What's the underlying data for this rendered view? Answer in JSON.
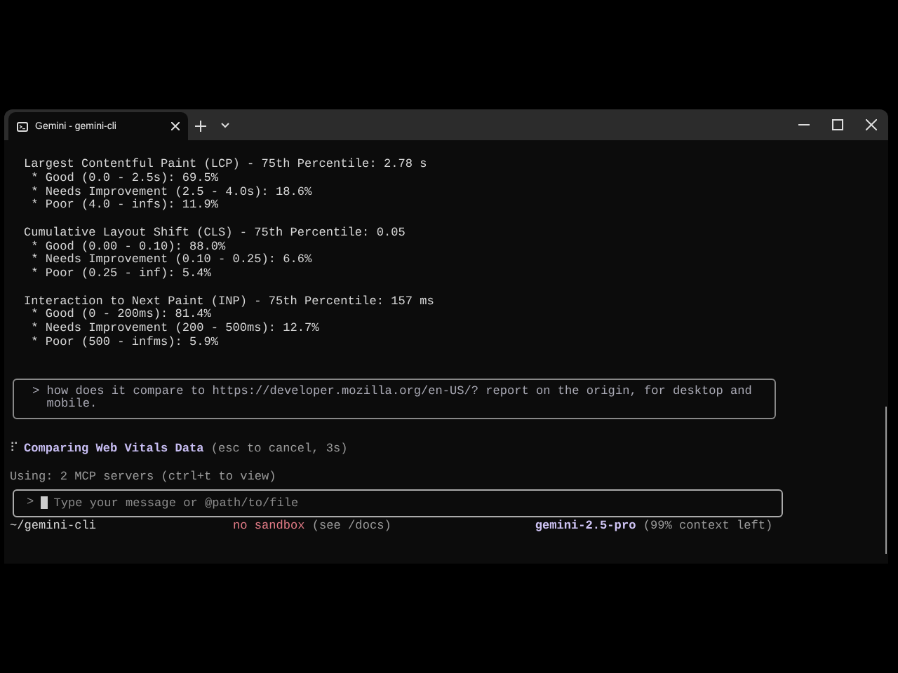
{
  "window": {
    "tabs": [
      {
        "title": "Gemini - gemini-cli",
        "selected": true
      }
    ]
  },
  "report": [
    {
      "heading": "Largest Contentful Paint (LCP) - 75th Percentile: 2.78 s",
      "items": [
        "* Good (0.0 - 2.5s): 69.5%",
        "* Needs Improvement (2.5 - 4.0s): 18.6%",
        "* Poor (4.0 - infs): 11.9%"
      ]
    },
    {
      "heading": "Cumulative Layout Shift (CLS) - 75th Percentile: 0.05",
      "items": [
        "* Good (0.00 - 0.10): 88.0%",
        "* Needs Improvement (0.10 - 0.25): 6.6%",
        "* Poor (0.25 - inf): 5.4%"
      ]
    },
    {
      "heading": "Interaction to Next Paint (INP) - 75th Percentile: 157 ms",
      "items": [
        "* Good (0 - 200ms): 81.4%",
        "* Needs Improvement (200 - 500ms): 12.7%",
        "* Poor (500 - infms): 5.9%"
      ]
    }
  ],
  "user_prompt": {
    "marker": ">",
    "text": "how does it compare to https://developer.mozilla.org/en-US/? report on the origin, for desktop and mobile."
  },
  "activity": {
    "spinner": "⠏",
    "title": "Comparing Web Vitals Data",
    "hint": "(esc to cancel, 3s)"
  },
  "mcp_status": "Using: 2 MCP servers (ctrl+t to view)",
  "input": {
    "marker": ">",
    "placeholder": "Type your message or @path/to/file"
  },
  "footer": {
    "path": "~/gemini-cli",
    "sandbox": "no sandbox",
    "sandbox_hint": "(see /docs)",
    "model": "gemini-2.5-pro",
    "context": "(99% context left)"
  }
}
